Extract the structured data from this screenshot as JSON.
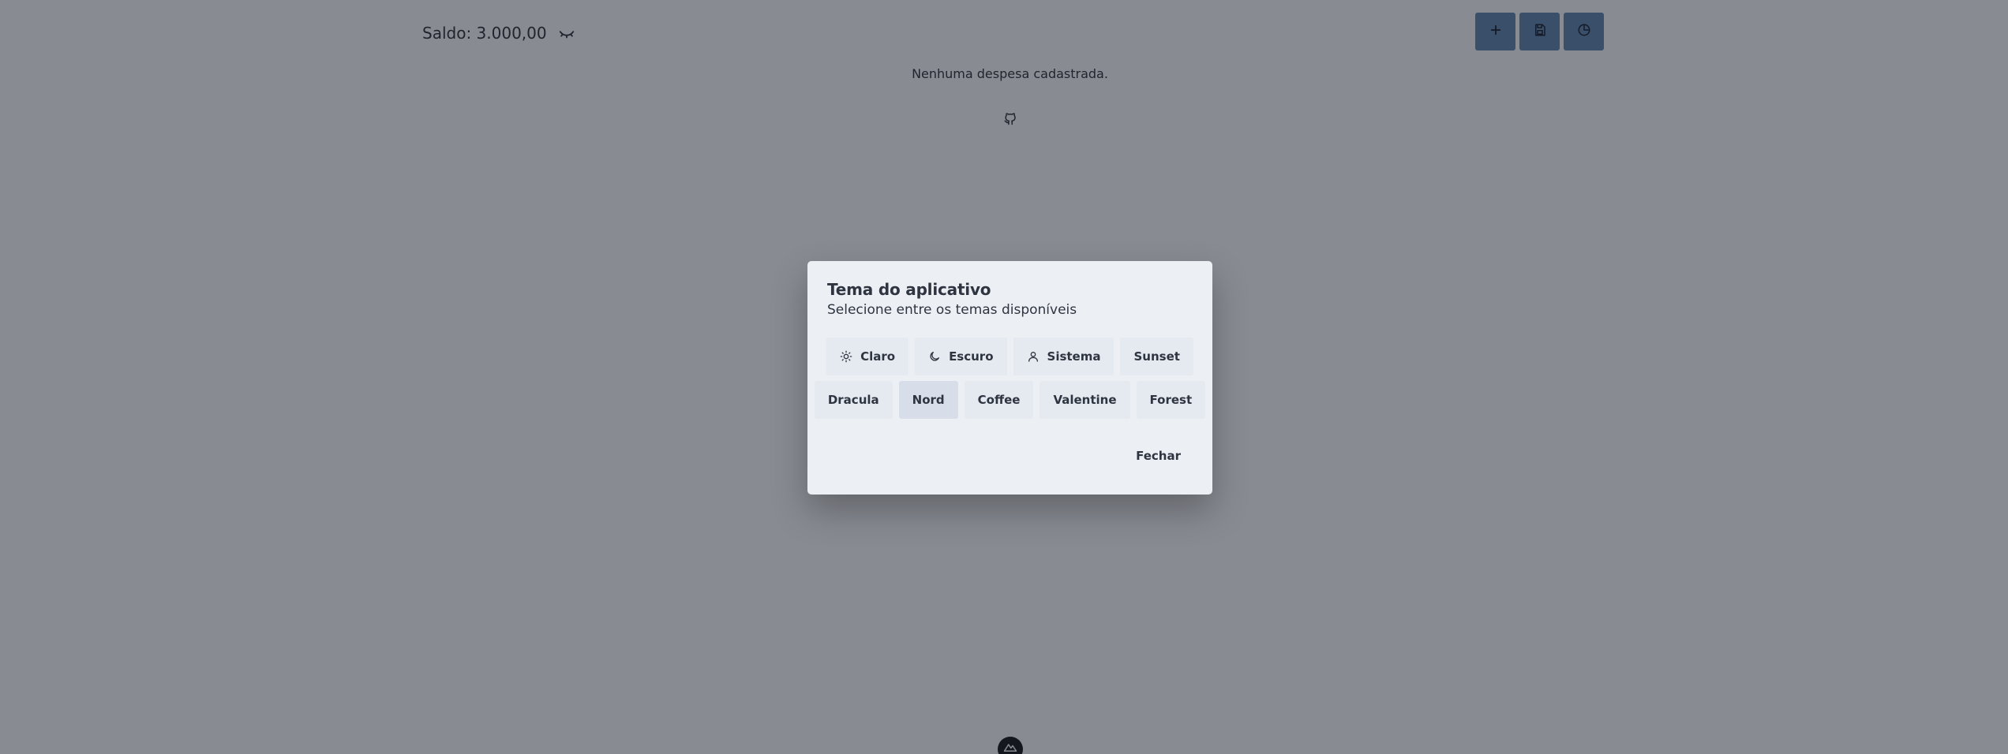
{
  "balance": {
    "label": "Saldo: 3.000,00",
    "toggle_icon": "eye-closed-icon"
  },
  "toolbar": {
    "buttons": [
      {
        "icon": "plus-icon"
      },
      {
        "icon": "save-icon"
      },
      {
        "icon": "chart-pie-icon"
      }
    ],
    "accent_color": "#5e81ac"
  },
  "content": {
    "empty_message": "Nenhuma despesa cadastrada.",
    "footer_icon": "github-icon"
  },
  "dialog": {
    "title": "Tema do aplicativo",
    "subtitle": "Selecione entre os temas disponíveis",
    "themes_row1": [
      {
        "label": "Claro",
        "icon": "sun-icon"
      },
      {
        "label": "Escuro",
        "icon": "moon-icon"
      },
      {
        "label": "Sistema",
        "icon": "user-icon"
      },
      {
        "label": "Sunset"
      }
    ],
    "themes_row2": [
      {
        "label": "Dracula"
      },
      {
        "label": "Nord",
        "selected": true
      },
      {
        "label": "Coffee"
      },
      {
        "label": "Valentine"
      },
      {
        "label": "Forest"
      }
    ],
    "close_label": "Fechar"
  }
}
